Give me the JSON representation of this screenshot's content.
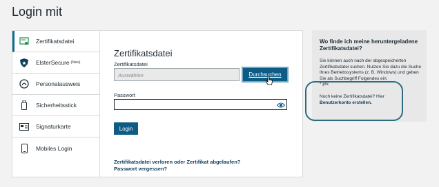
{
  "page": {
    "title": "Login mit"
  },
  "nav": {
    "items": [
      {
        "label": "Zertifikatsdatei",
        "icon": "certificate-icon",
        "active": true
      },
      {
        "label": "ElsterSecure",
        "sup": "(Neu)",
        "icon": "shield-icon"
      },
      {
        "label": "Personalausweis",
        "icon": "id-card-icon"
      },
      {
        "label": "Sicherheitsstick",
        "icon": "usb-stick-icon"
      },
      {
        "label": "Signaturkarte",
        "icon": "signature-card-icon"
      },
      {
        "label": "Mobiles Login",
        "icon": "smartphone-icon"
      }
    ]
  },
  "form": {
    "title": "Zertifikatsdatei",
    "file_label": "Zertifikatsdatei",
    "file_placeholder": "Auswählen",
    "browse_label": "Durchsuchen",
    "password_label": "Passwort",
    "password_value": "",
    "login_label": "Login",
    "link_lost": "Zertifikatsdatei verloren oder Zertifikat abgelaufen?",
    "link_forgot": "Passwort vergessen?"
  },
  "info": {
    "title": "Wo finde ich meine heruntergeladene Zertifikatsdatei?",
    "text": "Sie können auch nach der abgespeicherten Zertifikatsdatei suchen. Nutzen Sie dazu die Suche Ihres Betriebssystems (z. B. Windows) und geben Sie als Suchbegriff Folgendes ein:",
    "ext": "*.pfx",
    "no_cert": "Noch keine Zertifikatsdatei? Hier",
    "create_link": "Benutzerkonto erstellen."
  },
  "colors": {
    "accent": "#0d5c86",
    "highlight_ring": "#2b6d7e"
  }
}
